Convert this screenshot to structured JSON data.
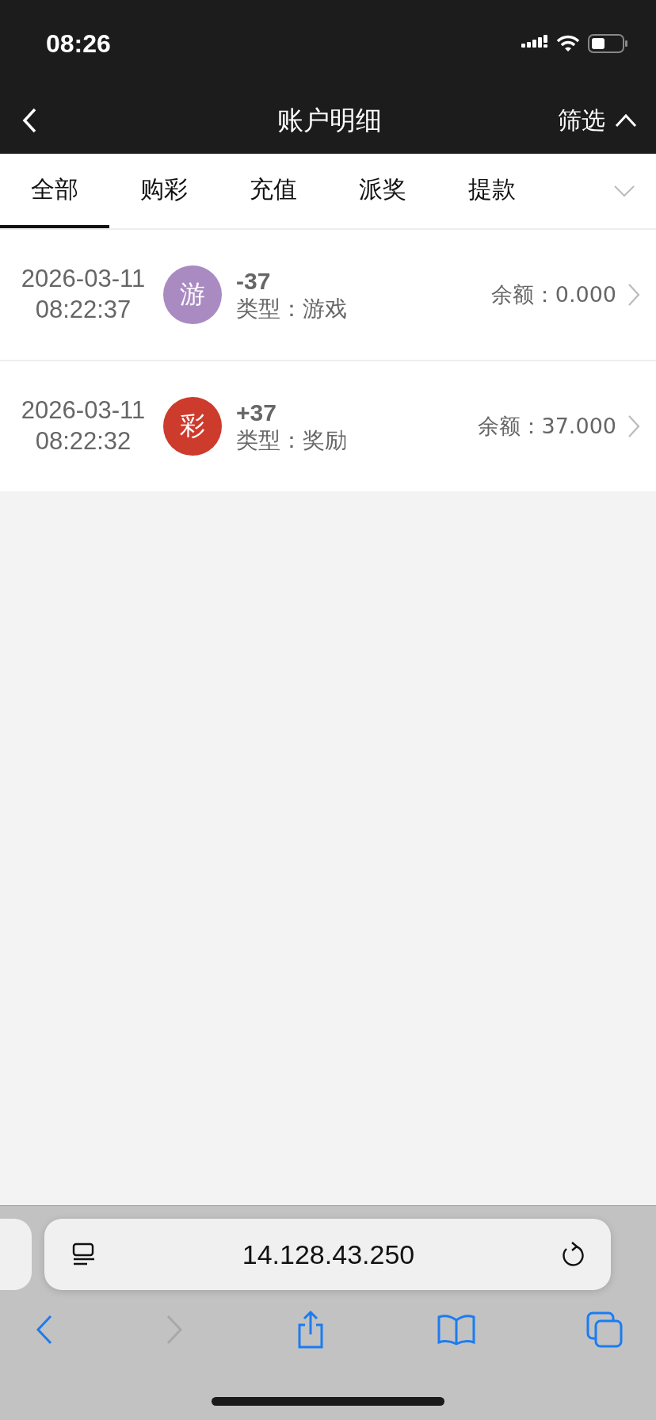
{
  "status_bar": {
    "time": "08:26"
  },
  "header": {
    "title": "账户明细",
    "filter_label": "筛选"
  },
  "tabs": [
    {
      "label": "全部",
      "selected": true
    },
    {
      "label": "购彩",
      "selected": false
    },
    {
      "label": "充值",
      "selected": false
    },
    {
      "label": "派奖",
      "selected": false
    },
    {
      "label": "提款",
      "selected": false
    }
  ],
  "records": [
    {
      "date": "2026-03-11",
      "time": "08:22:37",
      "badge": "游",
      "color": "#a98bc1",
      "amount": "-37",
      "type_label": "类型：",
      "type": "游戏",
      "balance_label": "余额：",
      "balance": "0.000"
    },
    {
      "date": "2026-03-11",
      "time": "08:22:32",
      "badge": "彩",
      "color": "#cc3b2c",
      "amount": "+37",
      "type_label": "类型：",
      "type": "奖励",
      "balance_label": "余额：",
      "balance": "37.000"
    }
  ],
  "browser": {
    "url": "14.128.43.250",
    "back_disabled": false,
    "forward_disabled": true
  }
}
